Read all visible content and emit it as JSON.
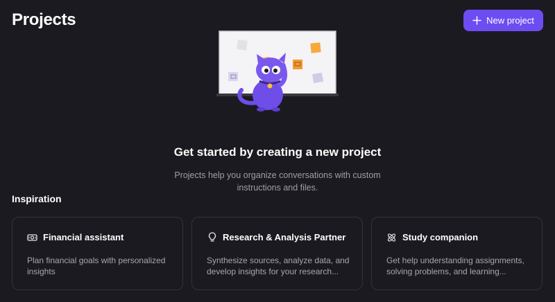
{
  "header": {
    "title": "Projects",
    "new_button_label": "New project",
    "new_button_icon": "plus-icon"
  },
  "empty_state": {
    "title": "Get started by creating a new project",
    "description": "Projects help you organize conversations with custom instructions and files."
  },
  "inspiration": {
    "title": "Inspiration",
    "cards": [
      {
        "icon": "money-icon",
        "title": "Financial assistant",
        "description": "Plan financial goals with personalized insights"
      },
      {
        "icon": "lightbulb-icon",
        "title": "Research & Analysis Partner",
        "description": "Synthesize sources, analyze data, and develop insights for your research..."
      },
      {
        "icon": "atom-icon",
        "title": "Study companion",
        "description": "Get help understanding assignments, solving problems, and learning..."
      }
    ]
  },
  "colors": {
    "background": "#1b1a20",
    "accent": "#6d4df2",
    "card_border": "#34333b",
    "muted_text": "#a09fa8"
  }
}
